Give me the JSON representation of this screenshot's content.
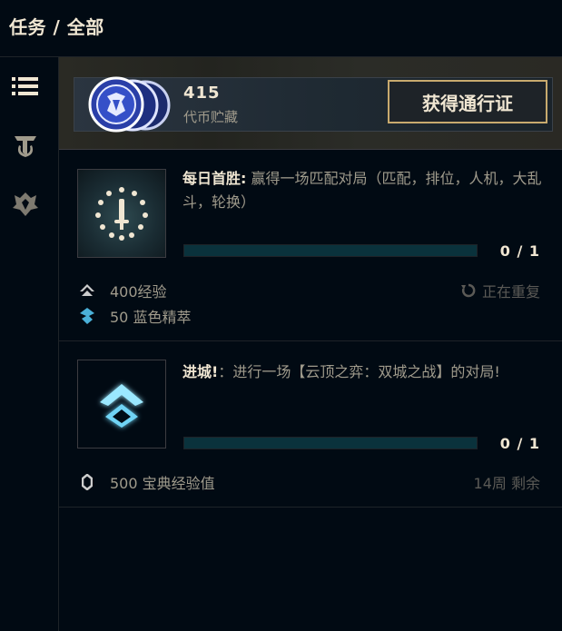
{
  "header": {
    "title": "任务 / 全部"
  },
  "sidebar": {
    "items": [
      {
        "icon": "list-icon"
      },
      {
        "icon": "tft-icon"
      },
      {
        "icon": "crest-icon"
      }
    ]
  },
  "banner": {
    "token_count": "415",
    "token_label": "代币贮藏",
    "button_label": "获得通行证"
  },
  "missions": [
    {
      "title": "每日首胜:",
      "description": "赢得一场匹配对局（匹配，排位，人机，大乱斗，轮换）",
      "progress_label": "0 / 1",
      "progress": 0,
      "rewards": [
        {
          "icon": "xp-icon",
          "label": "400经验"
        },
        {
          "icon": "blue-essence-icon",
          "label": "50 蓝色精萃"
        }
      ],
      "note": "正在重复"
    },
    {
      "title": "进城!",
      "description": "：进行一场【云顶之弈：双城之战】的对局!",
      "progress_label": "0 / 1",
      "progress": 0,
      "rewards": [
        {
          "icon": "codex-xp-icon",
          "label": "500 宝典经验值"
        }
      ],
      "note": "14周 剩余"
    }
  ]
}
